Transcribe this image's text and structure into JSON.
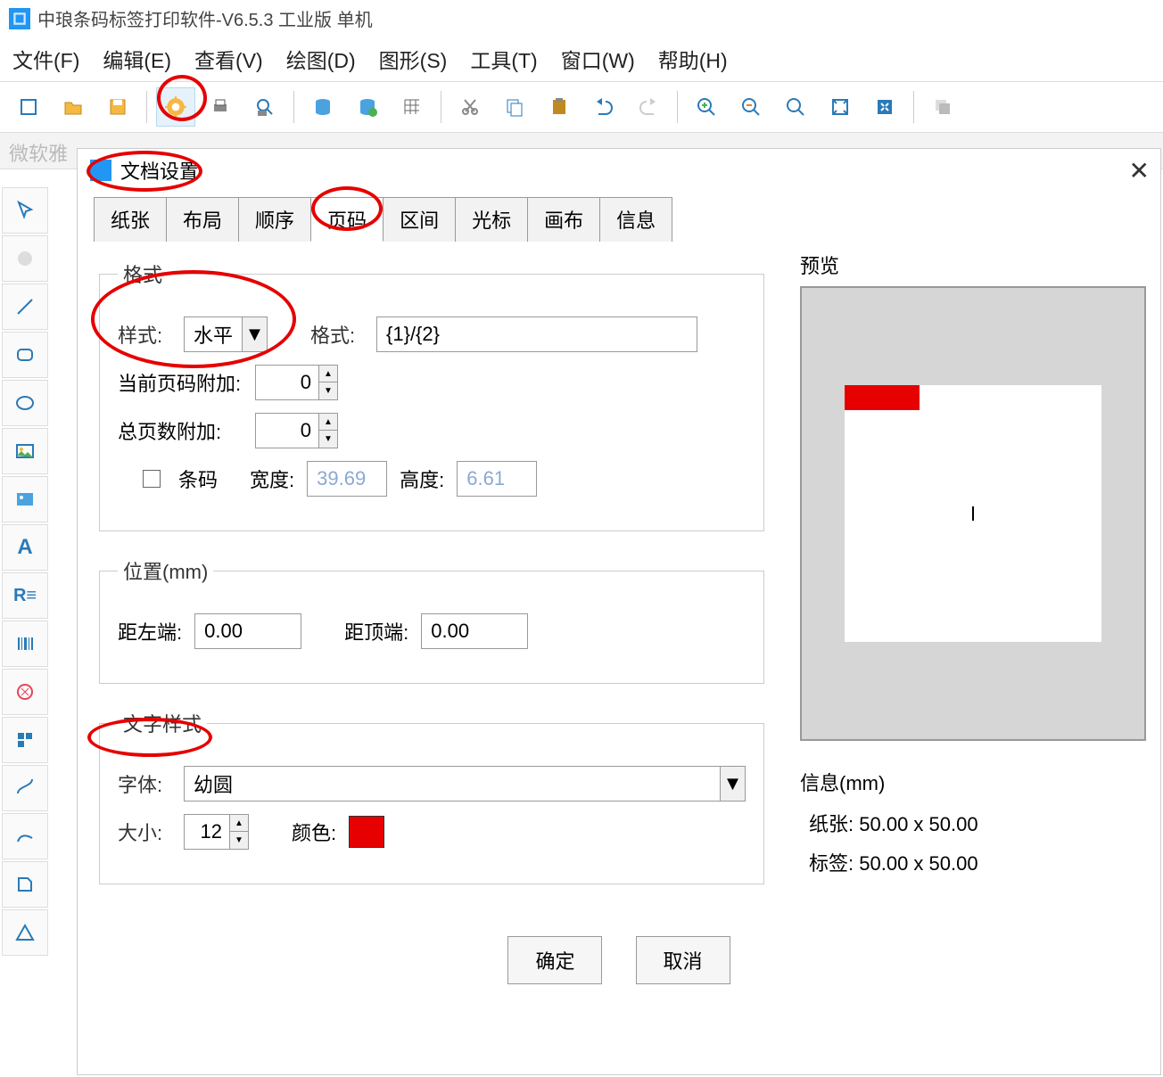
{
  "app": {
    "title": "中琅条码标签打印软件-V6.5.3 工业版 单机"
  },
  "menu": {
    "file": "文件(F)",
    "edit": "编辑(E)",
    "view": "查看(V)",
    "draw": "绘图(D)",
    "shape": "图形(S)",
    "tool": "工具(T)",
    "window": "窗口(W)",
    "help": "帮助(H)"
  },
  "secbar": {
    "font_hint": "微软雅"
  },
  "dialog": {
    "title": "文档设置",
    "tabs": [
      "纸张",
      "布局",
      "顺序",
      "页码",
      "区间",
      "光标",
      "画布",
      "信息"
    ],
    "active_tab": "页码"
  },
  "format": {
    "legend": "格式",
    "style_label": "样式:",
    "style_value": "水平",
    "format_label": "格式:",
    "format_value": "{1}/{2}",
    "curpage_label": "当前页码附加:",
    "curpage_value": "0",
    "total_label": "总页数附加:",
    "total_value": "0",
    "barcode_label": "条码",
    "width_label": "宽度:",
    "width_value": "39.69",
    "height_label": "高度:",
    "height_value": "6.61"
  },
  "position": {
    "legend": "位置(mm)",
    "left_label": "距左端:",
    "left_value": "0.00",
    "top_label": "距顶端:",
    "top_value": "0.00"
  },
  "textstyle": {
    "legend": "文字样式",
    "font_label": "字体:",
    "font_value": "幼圆",
    "size_label": "大小:",
    "size_value": "12",
    "color_label": "颜色:",
    "color_value": "#e60000"
  },
  "preview": {
    "title": "预览"
  },
  "info": {
    "title": "信息(mm)",
    "paper_label": "纸张:",
    "paper_value": "50.00 x 50.00",
    "label_label": "标签:",
    "label_value": "50.00 x 50.00"
  },
  "buttons": {
    "ok": "确定",
    "cancel": "取消"
  }
}
